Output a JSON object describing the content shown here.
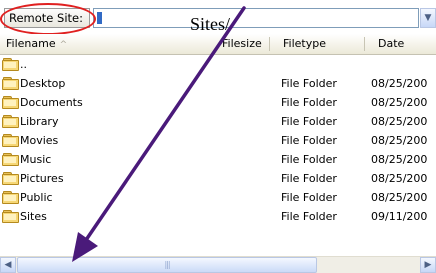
{
  "toolbar": {
    "remote_site_label": "Remote Site:",
    "path_value": "Sites/",
    "dropdown_icon": "chevron-down-icon"
  },
  "columns": [
    {
      "label": "Filename",
      "sort_indicator": "^"
    },
    {
      "label": "Filesize"
    },
    {
      "label": "Filetype"
    },
    {
      "label": "Date"
    }
  ],
  "files": [
    {
      "name": "..",
      "type": "",
      "date": ""
    },
    {
      "name": "Desktop",
      "type": "File Folder",
      "date": "08/25/200"
    },
    {
      "name": "Documents",
      "type": "File Folder",
      "date": "08/25/200"
    },
    {
      "name": "Library",
      "type": "File Folder",
      "date": "08/25/200"
    },
    {
      "name": "Movies",
      "type": "File Folder",
      "date": "08/25/200"
    },
    {
      "name": "Music",
      "type": "File Folder",
      "date": "08/25/200"
    },
    {
      "name": "Pictures",
      "type": "File Folder",
      "date": "08/25/200"
    },
    {
      "name": "Public",
      "type": "File Folder",
      "date": "08/25/200"
    },
    {
      "name": "Sites",
      "type": "File Folder",
      "date": "09/11/200"
    }
  ],
  "scrollbar": {
    "left_icon": "arrow-left-icon",
    "right_icon": "arrow-right-icon",
    "grip": "|||"
  },
  "annotation": {
    "highlight_color": "#e02020",
    "arrow_color": "#4a1a7a"
  }
}
